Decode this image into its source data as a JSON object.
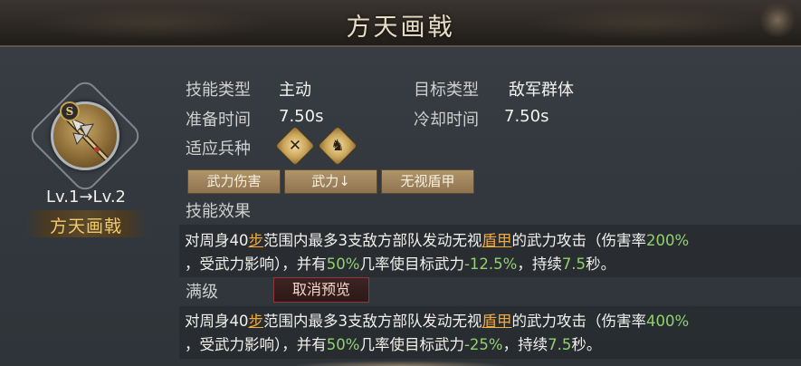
{
  "title": "方天画戟",
  "skill": {
    "grade": "S",
    "level_text": "Lv.1→Lv.2",
    "name": "方天画戟"
  },
  "info": {
    "skill_type_label": "技能类型",
    "skill_type_value": "主动",
    "target_type_label": "目标类型",
    "target_type_value": "敌军群体",
    "prep_time_label": "准备时间",
    "prep_time_value": "7.50s",
    "cooldown_label": "冷却时间",
    "cooldown_value": "7.50s",
    "troop_label": "适应兵种"
  },
  "troop_icons": [
    "crossed-weapons-icon",
    "cavalry-horse-icon"
  ],
  "tags": [
    "武力伤害",
    "武力↓",
    "无视盾甲"
  ],
  "effect": {
    "section_label": "技能效果",
    "t1": "对周身40",
    "t2": "步",
    "t3": "范围内最多3支敌方部队发动无视",
    "t4": "盾甲",
    "t5": "的武力攻击（伤害率",
    "t6": "200%",
    "t7": "，受武力影响），并有",
    "t8": "50%",
    "t9": "几率使目标武力",
    "t10": "-12.5%",
    "t11": "，持续",
    "t12": "7.5",
    "t13": "秒。"
  },
  "max_level": {
    "section_label": "满级",
    "cancel_preview_label": "取消预览",
    "t1": "对周身40",
    "t2": "步",
    "t3": "范围内最多3支敌方部队发动无视",
    "t4": "盾甲",
    "t5": "的武力攻击（伤害率",
    "t6": "400%",
    "t7": "，受武力影响），并有",
    "t8": "50%",
    "t9": "几率使目标武力",
    "t10": "-25%",
    "t11": "，持续",
    "t12": "7.5",
    "t13": "秒。"
  },
  "colors": {
    "highlight_orange": "#f2a93b",
    "highlight_green": "#8fd36a",
    "skill_name_gold": "#f2c96a"
  }
}
